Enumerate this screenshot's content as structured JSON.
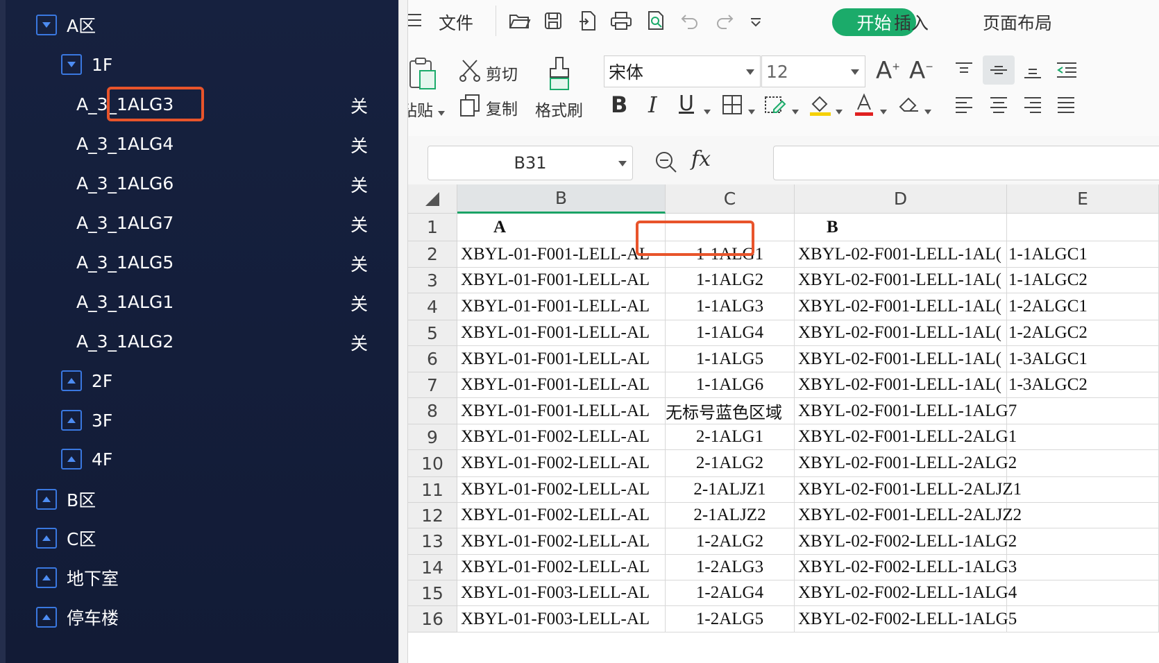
{
  "tree": {
    "nodes": [
      {
        "label": "A区",
        "state": "expanded",
        "level": 0
      },
      {
        "label": "1F",
        "state": "expanded",
        "level": 1
      },
      {
        "label": "2F",
        "state": "collapsed",
        "level": 1
      },
      {
        "label": "3F",
        "state": "collapsed",
        "level": 1
      },
      {
        "label": "4F",
        "state": "collapsed",
        "level": 1
      },
      {
        "label": "B区",
        "state": "collapsed",
        "level": 0
      },
      {
        "label": "C区",
        "state": "collapsed",
        "level": 0
      },
      {
        "label": "地下室",
        "state": "collapsed",
        "level": 0
      },
      {
        "label": "停车楼",
        "state": "collapsed",
        "level": 0
      }
    ],
    "leaves": [
      {
        "label": "A_3_1ALG3",
        "status": "关"
      },
      {
        "label": "A_3_1ALG4",
        "status": "关"
      },
      {
        "label": "A_3_1ALG6",
        "status": "关"
      },
      {
        "label": "A_3_1ALG7",
        "status": "关"
      },
      {
        "label": "A_3_1ALG5",
        "status": "关"
      },
      {
        "label": "A_3_1ALG1",
        "status": "关"
      },
      {
        "label": "A_3_1ALG2",
        "status": "关"
      }
    ]
  },
  "menu": {
    "file": "文件",
    "start": "开始",
    "insert": "插入",
    "layout": "页面布局"
  },
  "toolbar": {
    "paste": "粘贴",
    "cut": "剪切",
    "copy": "复制",
    "format_painter": "格式刷",
    "font_name": "宋体",
    "font_size": "12",
    "bold": "B",
    "italic": "I",
    "underline": "U",
    "grow_font": "A",
    "shrink_font": "A"
  },
  "formula": {
    "name_box": "B31",
    "fx": "fx",
    "value": ""
  },
  "sheet": {
    "columns": [
      "B",
      "C",
      "D",
      "E"
    ],
    "rows": [
      {
        "n": "1",
        "B": "A",
        "C": "",
        "D": "B",
        "E": ""
      },
      {
        "n": "2",
        "B": "XBYL-01-F001-LELL-AL",
        "C": "1-1ALG1",
        "D": "XBYL-02-F001-LELL-1AL(",
        "E": "1-1ALGC1"
      },
      {
        "n": "3",
        "B": "XBYL-01-F001-LELL-AL",
        "C": "1-1ALG2",
        "D": "XBYL-02-F001-LELL-1AL(",
        "E": "1-1ALGC2"
      },
      {
        "n": "4",
        "B": "XBYL-01-F001-LELL-AL",
        "C": "1-1ALG3",
        "D": "XBYL-02-F001-LELL-1AL(",
        "E": "1-2ALGC1"
      },
      {
        "n": "5",
        "B": "XBYL-01-F001-LELL-AL",
        "C": "1-1ALG4",
        "D": "XBYL-02-F001-LELL-1AL(",
        "E": "1-2ALGC2"
      },
      {
        "n": "6",
        "B": "XBYL-01-F001-LELL-AL",
        "C": "1-1ALG5",
        "D": "XBYL-02-F001-LELL-1AL(",
        "E": "1-3ALGC1"
      },
      {
        "n": "7",
        "B": "XBYL-01-F001-LELL-AL",
        "C": "1-1ALG6",
        "D": "XBYL-02-F001-LELL-1AL(",
        "E": "1-3ALGC2"
      },
      {
        "n": "8",
        "B": "XBYL-01-F001-LELL-AL",
        "C": "无标号蓝色区域",
        "D": "XBYL-02-F001-LELL-1ALG7",
        "E": ""
      },
      {
        "n": "9",
        "B": "XBYL-01-F002-LELL-AL",
        "C": "2-1ALG1",
        "D": "XBYL-02-F001-LELL-2ALG1",
        "E": ""
      },
      {
        "n": "10",
        "B": "XBYL-01-F002-LELL-AL",
        "C": "2-1ALG2",
        "D": "XBYL-02-F001-LELL-2ALG2",
        "E": ""
      },
      {
        "n": "11",
        "B": "XBYL-01-F002-LELL-AL",
        "C": "2-1ALJZ1",
        "D": "XBYL-02-F001-LELL-2ALJZ1",
        "E": ""
      },
      {
        "n": "12",
        "B": "XBYL-01-F002-LELL-AL",
        "C": "2-1ALJZ2",
        "D": "XBYL-02-F001-LELL-2ALJZ2",
        "E": ""
      },
      {
        "n": "13",
        "B": "XBYL-01-F002-LELL-AL",
        "C": "1-2ALG2",
        "D": "XBYL-02-F002-LELL-1ALG2",
        "E": ""
      },
      {
        "n": "14",
        "B": "XBYL-01-F002-LELL-AL",
        "C": "1-2ALG3",
        "D": "XBYL-02-F002-LELL-1ALG3",
        "E": ""
      },
      {
        "n": "15",
        "B": "XBYL-01-F003-LELL-AL",
        "C": "1-2ALG4",
        "D": "XBYL-02-F002-LELL-1ALG4",
        "E": ""
      },
      {
        "n": "16",
        "B": "XBYL-01-F003-LELL-AL",
        "C": "1-2ALG5",
        "D": "XBYL-02-F002-LELL-1ALG5",
        "E": ""
      }
    ]
  },
  "colors": {
    "panel_bg": "#16213f",
    "accent_green": "#1bab6a",
    "highlight": "#e8542b",
    "tree_icon": "#4d8cf2"
  }
}
